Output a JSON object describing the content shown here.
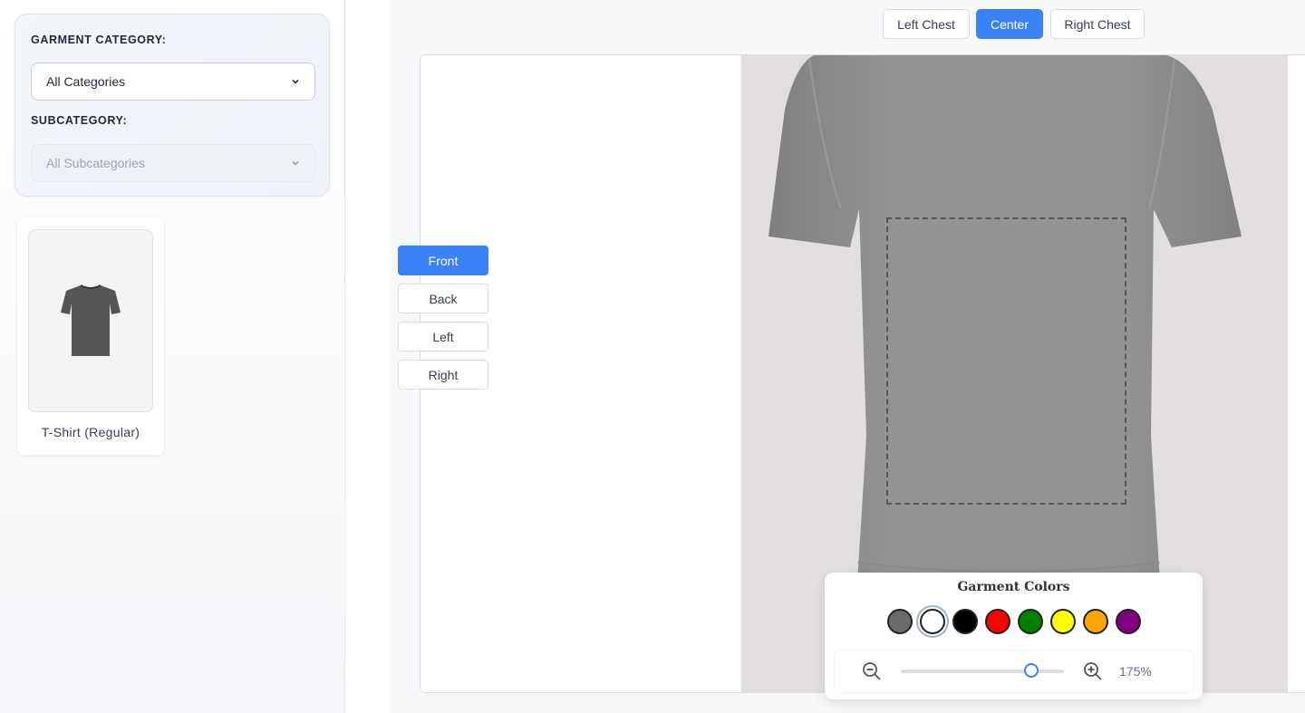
{
  "sidebar": {
    "category_label": "GARMENT CATEGORY:",
    "category_value": "All Categories",
    "subcategory_label": "SUBCATEGORY:",
    "subcategory_value": "All Subcategories",
    "products": [
      {
        "name": "T-Shirt (Regular)",
        "icon": "tshirt-thumbnail"
      }
    ]
  },
  "placement": {
    "options": [
      "Left Chest",
      "Center",
      "Right Chest"
    ],
    "selected": "Center"
  },
  "views": {
    "options": [
      "Front",
      "Back",
      "Left",
      "Right"
    ],
    "selected": "Front"
  },
  "garment_colors": {
    "title": "Garment Colors",
    "swatches": [
      "#6b6b6b",
      "#ffffff",
      "#000000",
      "#ff0000",
      "#008000",
      "#ffff00",
      "#ffa500",
      "#800080"
    ],
    "selected_index": 1
  },
  "zoom": {
    "value_label": "175%",
    "level_fraction": 0.8,
    "zoom_out_icon": "zoom-out-icon",
    "zoom_in_icon": "zoom-in-icon"
  },
  "colors": {
    "accent": "#3b82f6",
    "shirt": "#8e8e8e"
  }
}
